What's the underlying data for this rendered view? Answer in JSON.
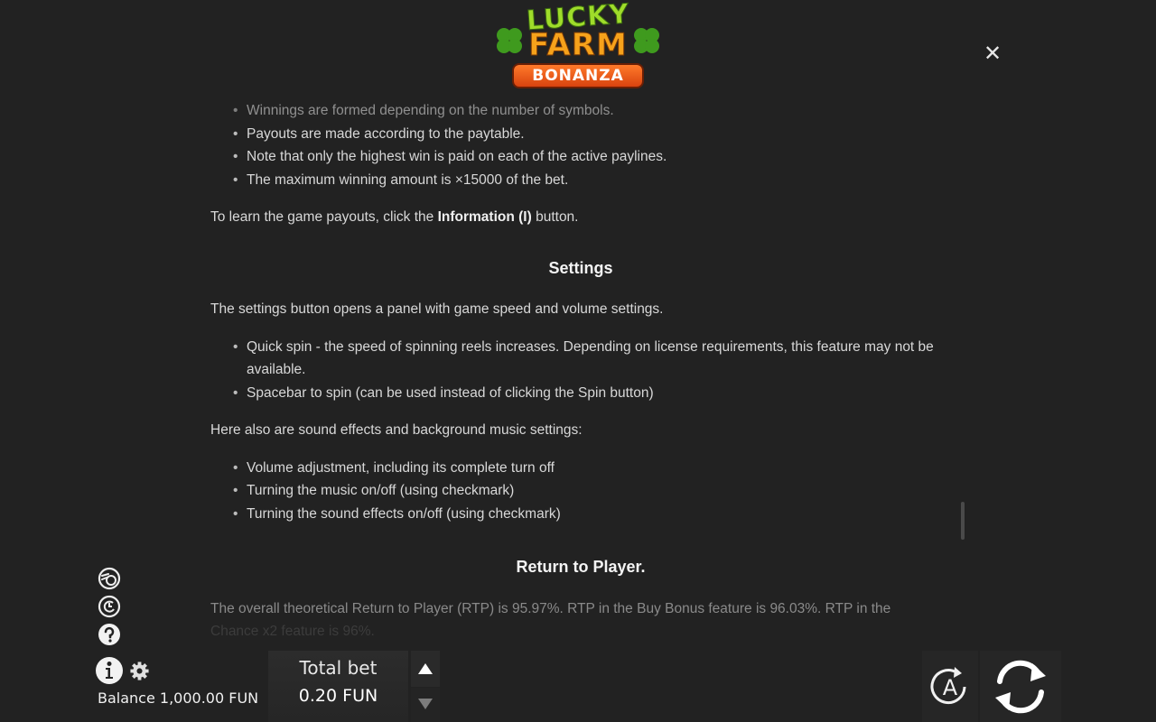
{
  "logo": {
    "line1": "LUCKY",
    "line2": "FARM",
    "line3": "BONANZA"
  },
  "close": {
    "symbol": "✕",
    "icon": "close-icon"
  },
  "rules_list_top": [
    "Winnings are formed depending on the number of symbols.",
    "Payouts are made according to the paytable.",
    "Note that only the highest win is paid on each of the active paylines.",
    "The maximum winning amount is ×15000 of the bet."
  ],
  "payouts_note": {
    "before": "To learn the game payouts, click the ",
    "bold": "Information (I)",
    "after": " button."
  },
  "settings": {
    "title": "Settings",
    "intro": "The settings button opens a panel with game speed and volume settings.",
    "items": [
      "Quick spin - the speed of spinning reels increases. Depending on license requirements, this feature may not be available.",
      "Spacebar to spin (can be used instead of clicking the Spin button)"
    ],
    "sound_intro": "Here also are sound effects and background music settings:",
    "sound_items": [
      "Volume adjustment, including its complete turn off",
      "Turning the music on/off (using checkmark)",
      "Turning the sound effects on/off (using checkmark)"
    ]
  },
  "rtp": {
    "title": "Return to Player.",
    "line1": "The overall theoretical Return to Player (RTP) is 95.97%. RTP in the Buy Bonus feature is 96.03%. RTP in the",
    "line2": "Chance x2 feature is 96%."
  },
  "side_icons": [
    "bet-coins-icon",
    "history-icon",
    "help-icon",
    "info-icon",
    "gear-icon"
  ],
  "balance": "Balance 1,000.00 FUN",
  "bet": {
    "label": "Total bet",
    "value": "0.20 FUN"
  },
  "autoplay": {
    "letter": "A"
  },
  "colors": {
    "background": "#222222",
    "text": "#d8d8d8",
    "heading": "#f4f4f4"
  }
}
